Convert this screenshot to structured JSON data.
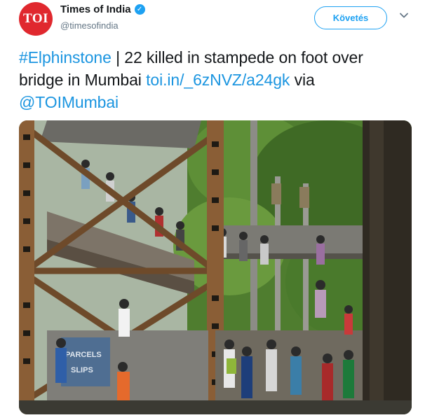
{
  "account": {
    "display_name": "Times of India",
    "handle": "@timesofindia",
    "avatar_text": "TOI",
    "verified": true
  },
  "actions": {
    "follow_label": "Követés"
  },
  "tweet": {
    "hashtag": "#Elphinstone",
    "text_main": " | 22 killed in stampede on foot over bridge in Mumbai ",
    "link": "toi.in/_6zNVZ/a24gk",
    "text_via": " via ",
    "mention": "@TOIMumbai"
  },
  "photo": {
    "sign_text": "PARCELS",
    "sign_text_2": "SLIPS"
  },
  "colors": {
    "accent": "#1da1f2",
    "link": "#1b95e0",
    "avatar_red": "#e0282e",
    "text": "#14171a",
    "secondary": "#657786"
  }
}
